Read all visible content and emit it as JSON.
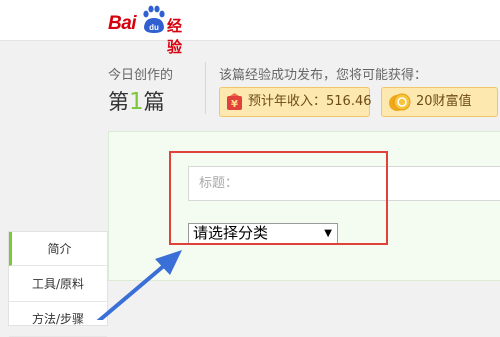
{
  "logo": {
    "bai": "Bai",
    "du": "du",
    "jingyan": "经验"
  },
  "header": {
    "today_label": "今日创作的",
    "today_prefix": "第",
    "today_number": "1",
    "today_suffix": "篇",
    "publish_tip": "该篇经验成功发布，您将可能获得：",
    "income_label": "预计年收入：516.46",
    "wealth_label": "20财富值"
  },
  "form": {
    "title_placeholder": "标题：",
    "category_selected": "请选择分类"
  },
  "side_nav": {
    "items": [
      {
        "label": "简介"
      },
      {
        "label": "工具/原料"
      },
      {
        "label": "方法/步骤"
      }
    ]
  },
  "colors": {
    "brand_red": "#d6000f",
    "accent_green": "#7ec73a",
    "annotation_red": "#e0413b",
    "annotation_blue": "#3a6fd8"
  }
}
